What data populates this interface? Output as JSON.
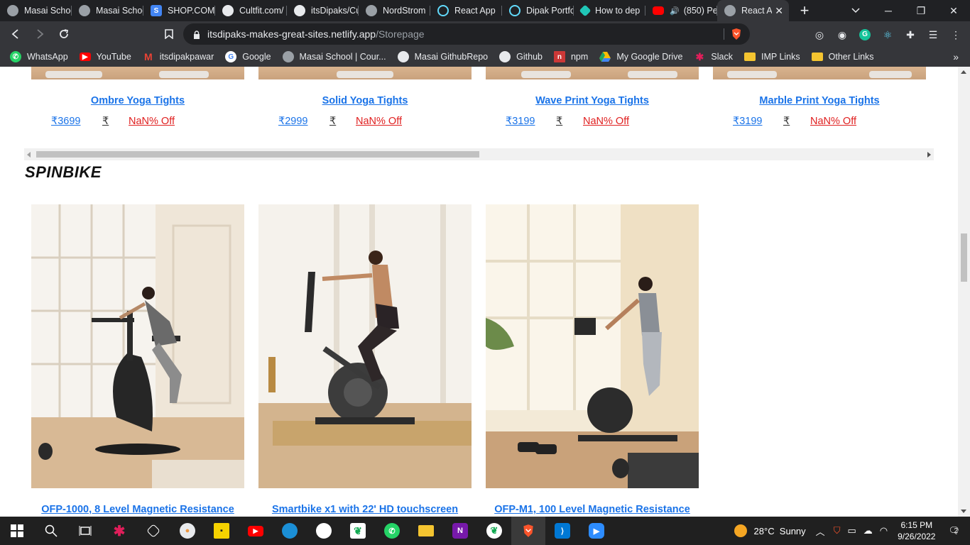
{
  "browser": {
    "tabs": [
      {
        "title": "Masai Schoo",
        "icon": "globe-icon",
        "color": "#9aa0a6"
      },
      {
        "title": "Masai Schoo",
        "icon": "globe-icon",
        "color": "#9aa0a6"
      },
      {
        "title": "SHOP.COM",
        "icon": "shop-s-icon",
        "color": "#4285f4"
      },
      {
        "title": "Cultfit.com/",
        "icon": "github-icon",
        "color": "#e8eaed"
      },
      {
        "title": "itsDipaks/Cu",
        "icon": "github-icon",
        "color": "#e8eaed"
      },
      {
        "title": "NordStrom",
        "icon": "globe-icon",
        "color": "#9aa0a6"
      },
      {
        "title": "React App",
        "icon": "react-icon",
        "color": "#61dafb"
      },
      {
        "title": "Dipak Portfo",
        "icon": "react-icon",
        "color": "#61dafb"
      },
      {
        "title": "How to dep",
        "icon": "netlify-icon",
        "color": "#20c6b7"
      },
      {
        "title": "(850) Pe",
        "icon": "youtube-icon",
        "color": "#ff0000"
      },
      {
        "title": "React A",
        "icon": "globe-icon",
        "color": "#9aa0a6"
      }
    ],
    "url_host": "itsdipaks-makes-great-sites.netlify.app",
    "url_path": "/Storepage"
  },
  "bookmarks": [
    {
      "label": "WhatsApp",
      "icon": "whatsapp-icon",
      "color": "#25d366"
    },
    {
      "label": "YouTube",
      "icon": "youtube-icon",
      "color": "#ff0000"
    },
    {
      "label": "itsdipakpawar",
      "icon": "gmail-icon",
      "color": "#ea4335"
    },
    {
      "label": "Google",
      "icon": "google-icon",
      "color": "#ffffff"
    },
    {
      "label": "Masai School | Cour...",
      "icon": "globe-icon",
      "color": "#9aa0a6"
    },
    {
      "label": "Masai GithubRepo",
      "icon": "github-icon",
      "color": "#e8eaed"
    },
    {
      "label": "Github",
      "icon": "github-icon",
      "color": "#e8eaed"
    },
    {
      "label": "npm",
      "icon": "npm-icon",
      "color": "#cb3837"
    },
    {
      "label": "My Google Drive",
      "icon": "drive-icon",
      "color": "#fbbc04"
    },
    {
      "label": "Slack",
      "icon": "slack-icon",
      "color": "#e01e5a"
    },
    {
      "label": "IMP Links",
      "icon": "folder-icon",
      "color": "#f4c430"
    },
    {
      "label": "Other Links",
      "icon": "folder-icon",
      "color": "#f4c430"
    }
  ],
  "top_products": [
    {
      "title": "Ombre Yoga Tights",
      "price": "₹3699",
      "rupee": "₹",
      "discount": "NaN% Off"
    },
    {
      "title": "Solid Yoga Tights",
      "price": "₹2999",
      "rupee": "₹",
      "discount": "NaN% Off"
    },
    {
      "title": "Wave Print Yoga Tights",
      "price": "₹3199",
      "rupee": "₹",
      "discount": "NaN% Off"
    },
    {
      "title": "Marble Print Yoga Tights",
      "price": "₹3199",
      "rupee": "₹",
      "discount": "NaN% Off"
    }
  ],
  "section": {
    "heading": "SPINBIKE"
  },
  "spinbikes": [
    {
      "title": "OFP-1000, 8 Level Magnetic Resistance"
    },
    {
      "title": "Smartbike x1 with 22' HD touchscreen"
    },
    {
      "title": "OFP-M1, 100 Level Magnetic Resistance"
    }
  ],
  "taskbar": {
    "weather": "28°C  Sunny",
    "time": "6:15 PM",
    "date": "9/26/2022",
    "notifications": "2"
  }
}
